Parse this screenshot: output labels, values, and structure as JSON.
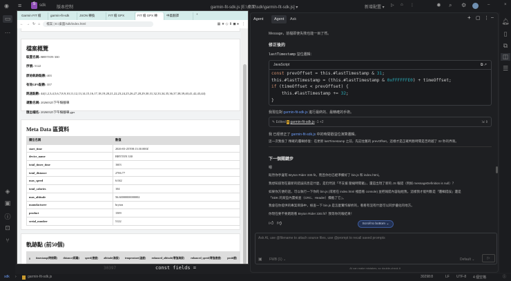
{
  "ide": {
    "project": "sdk",
    "vcs": "版本控制",
    "title": "garmin-fit-sdk.js [E:\\桌面\\sdk\\garmin-fit-sdk.js] ▾",
    "run_config": "新增配置 ▾",
    "editor_line": "30397",
    "editor_code": "const fields =",
    "breadcrumb": [
      "sdk",
      "garmin-fit-sdk.js"
    ],
    "status": [
      "30298:8",
      "LF",
      "UTF-8",
      "4 個空格"
    ]
  },
  "browser": {
    "tabs": [
      "Garmin FIT 檔",
      "garmin-fit-sdk",
      "JSON 轉換",
      "FIT 檔 GPX",
      "FIT 檔 GPX 轉",
      "中義翻譯"
    ],
    "url": "檔案 | E:/桌面/sdk/index.html",
    "summary": {
      "title": "檔案概覽",
      "items": [
        {
          "k": "裝置名稱:",
          "v": "BRYTON 330"
        },
        {
          "k": "序號:",
          "v": "5122"
        },
        {
          "k": "原始軌跡點數:",
          "v": "401"
        },
        {
          "k": "有效GPS點數:",
          "v": "357"
        },
        {
          "k": "跳過點數:",
          "v": "44(1,2,3,4,5,6,7,8,9,10,11,12,13,14,15,16,17,18,19,20,21,22,23,24,25,26,27,28,29,30,31,32,33,34,35,36,37,38,39,40,41,42,43,44)"
        },
        {
          "k": "運動名稱:",
          "v": "20260325下午騎腳車"
        },
        {
          "k": "匯出檔名:",
          "v": "20260325下午騎腳車.gpx"
        }
      ]
    },
    "meta": {
      "title": "Meta Data 區資料",
      "headers": [
        "欄位名稱",
        "數值"
      ],
      "rows": [
        [
          "start_time",
          "2026-03-25T08:13:30.000Z"
        ],
        [
          "device_name",
          "BRYTON 330"
        ],
        [
          "total_timer_time",
          "1603"
        ],
        [
          "total_distance",
          "2706.77"
        ],
        [
          "max_speed",
          "6.042"
        ],
        [
          "total_calories",
          "104"
        ],
        [
          "max_altitude",
          "56.60000000000002"
        ],
        [
          "manufacturer",
          "bryton"
        ],
        [
          "product",
          "1509"
        ],
        [
          "serial_number",
          "5122"
        ]
      ]
    },
    "track": {
      "title": "軌跡點 (前50個)",
      "headers": [
        "#",
        "timestamp(時間戳)",
        "distance(距離)",
        "speed(速度)",
        "altitude(海拔)",
        "temperature(溫度)",
        "enhanced_altitude(增強海拔)",
        "enhanced_speed(增強速度)",
        "positi度)"
      ]
    }
  },
  "agent": {
    "header": {
      "label": "Agent",
      "tabs": [
        "Agent",
        "Ask"
      ]
    },
    "intro": "Message，前檔即使失敗也能一目了然。",
    "fixed_title": "修正後的",
    "fixed_desc_code": "lastTimestamp",
    "fixed_desc": " 溢位邏輯：",
    "code_lang": "JavaScript",
    "after_code_1": "我現在對 ",
    "file": "garmin-fit-sdk.js",
    "after_code_2": " 進行最終的、最精確的手術。",
    "edited": {
      "label": "Edited",
      "file": "garmin-fit-sdk.js",
      "diff": "-1 +2"
    },
    "done_1": "我 已經修正了 ",
    "done_2": " 中的時間戳溢位演算邏輯。",
    "note": "這一次我換了 精確的邏輯修復：在更新 lastTimestamp 之前，先記住舊的 prevOffset，這樣才是正確判斷時間是否跨越了 32 秒的界限。",
    "next_title": "下一個關鍵步",
    "hmm": "嗯",
    "paras": [
      "既然你手邊有 Bryton Rider 330.fit，而且你也已經準備好了 bin.js 和 index.html。",
      "我想知道現在最新的錯誤訊息是什麼，是仍然說「不支援 壓縮時間戳」，還是出現了新的 JS 報錯（例如 messageDefinition is null）？",
      "如果你方便的話，可以執行一下你的 bin.js (或者在 index.html 裡面看 console) 並把報錯內容貼給我，這樣我才能判斷是「邏輯錯誤」還是",
      "「SDK 的某些內置檢查（CRC、Header）攔截了它」。",
      "我會在你提供的專案目錄中，檢查一下 bin.js 是怎麼實作解析的，看看有沒有什麼可以同步優化的地方。",
      "你現在要不要跑跑看 Bryton Rider 330.fit？我等你的報結果！"
    ],
    "scroll_btn": "Scroll to bottom ⌄",
    "input_placeholder": "Ask AI, use @filename to attach source files, use @prompt to recall saved prompts",
    "context": "FWB (1) ⌄",
    "model": "Default ⌄",
    "disclaimer": "AI can make mistakes, so double-check it"
  }
}
